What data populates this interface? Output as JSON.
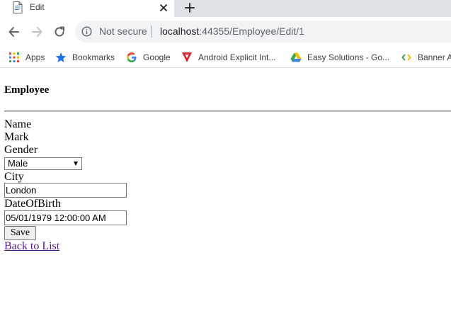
{
  "browser": {
    "tab": {
      "title": "Edit",
      "favicon": "document-icon",
      "close": "close-icon"
    },
    "new_tab": "plus-icon",
    "nav": {
      "back": "arrow-left-icon",
      "forward": "arrow-right-icon",
      "reload": "reload-icon"
    },
    "omnibox": {
      "security_icon": "info-icon",
      "security_text": "Not secure",
      "url_host": "localhost",
      "url_rest": ":44355/Employee/Edit/1"
    },
    "bookmarks": [
      {
        "label": "Apps",
        "icon": "apps-grid-icon"
      },
      {
        "label": "Bookmarks",
        "icon": "star-icon"
      },
      {
        "label": "Google",
        "icon": "google-icon"
      },
      {
        "label": "Android Explicit Int...",
        "icon": "triangle-logo-icon"
      },
      {
        "label": "Easy Solutions - Go...",
        "icon": "drive-icon"
      },
      {
        "label": "Banner A",
        "icon": "code-icon"
      }
    ],
    "colors": {
      "tabstrip": "#dee1e6",
      "omnibox": "#f1f3f4",
      "link": "#551a8b"
    }
  },
  "page": {
    "title": "Employee",
    "fields": {
      "name_label": "Name",
      "name_value": "Mark",
      "gender_label": "Gender",
      "gender_selected": "Male",
      "city_label": "City",
      "city_value": "London",
      "dob_label": "DateOfBirth",
      "dob_value": "05/01/1979 12:00:00 AM"
    },
    "save_label": "Save",
    "back_link": "Back to List"
  }
}
